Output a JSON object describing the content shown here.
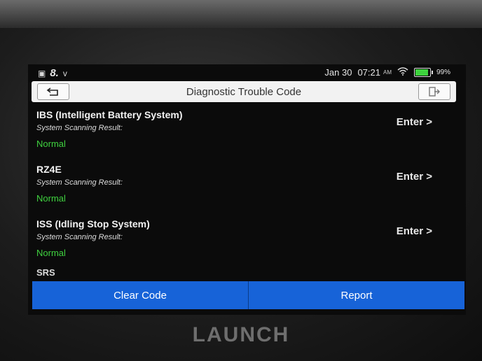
{
  "status_bar": {
    "left_value": "8.",
    "left_suffix": "v",
    "date": "Jan 30",
    "time": "07:21",
    "meridiem": "AM",
    "battery_pct": "99%",
    "battery_fill": 0.99,
    "battery_color": "#3ed33e"
  },
  "header": {
    "title": "Diagnostic Trouble Code"
  },
  "systems": [
    {
      "name": "IBS (Intelligent Battery System)",
      "result_label": "System Scanning Result:",
      "result": "Normal",
      "action": "Enter >"
    },
    {
      "name": "RZ4E",
      "result_label": "System Scanning Result:",
      "result": "Normal",
      "action": "Enter >"
    },
    {
      "name": "ISS (Idling Stop System)",
      "result_label": "System Scanning Result:",
      "result": "Normal",
      "action": "Enter >"
    }
  ],
  "partial_item": "SRS",
  "buttons": {
    "clear_code": "Clear Code",
    "report": "Report"
  },
  "brand": "LAUNCH",
  "colors": {
    "accent_button": "#1763d8",
    "normal_status": "#3fd13f"
  }
}
